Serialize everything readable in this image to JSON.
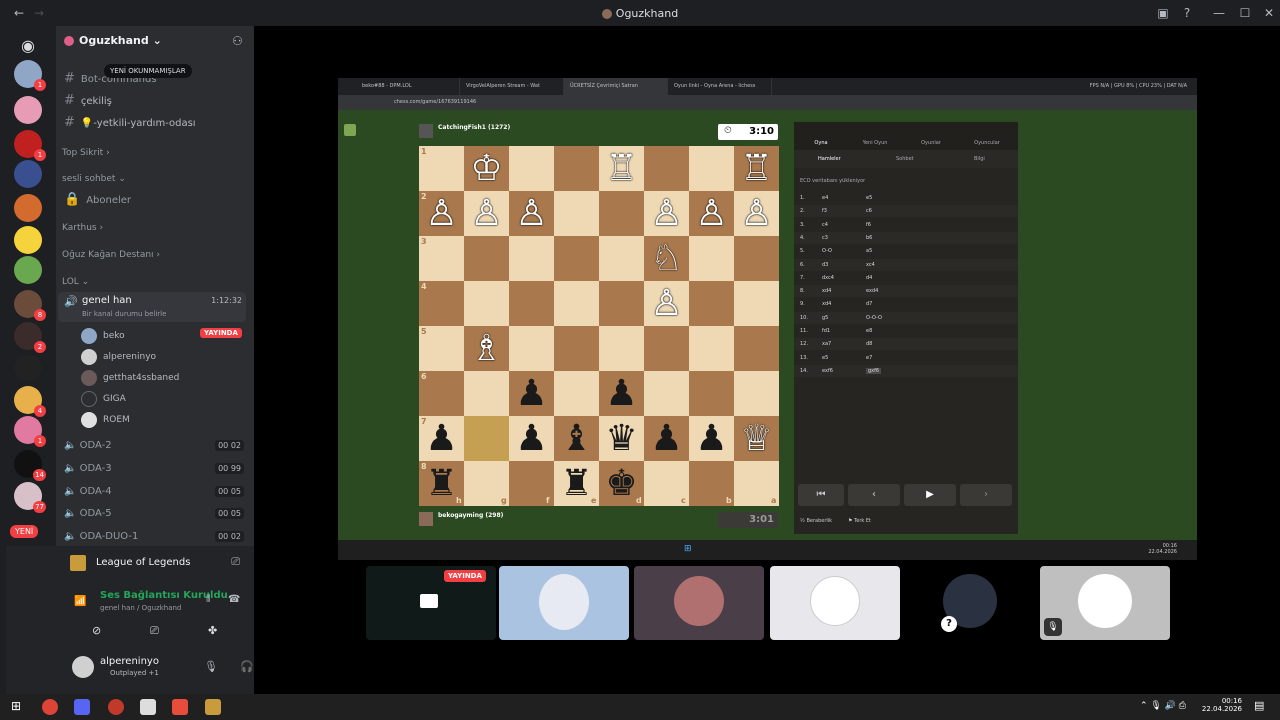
{
  "window": {
    "title": "Oguzkhand"
  },
  "server": {
    "name": "Oguzkhand",
    "tooltip": "YENİ OKUNMAMIŞLAR"
  },
  "text_channels": [
    {
      "name": "Bot-commands"
    },
    {
      "name": "çekiliş"
    },
    {
      "name": "💡-yetkili-yardım-odası"
    }
  ],
  "categories": {
    "top_sikrit": "Top Sikrit",
    "sesli_sohbet": "sesli sohbet",
    "aboneler": "Aboneler",
    "karthus": "Karthus",
    "oguz_kagan": "Oğuz Kağan Destanı",
    "lol": "LOL"
  },
  "voice_active": {
    "name": "genel han",
    "timer": "1:12:32",
    "status": "Bir kanal durumu belirle"
  },
  "voice_users": [
    {
      "name": "beko",
      "badge": "YAYINDA"
    },
    {
      "name": "alpereninyo"
    },
    {
      "name": "getthat4ssbaned"
    },
    {
      "name": "GIGA"
    },
    {
      "name": "ROEM"
    }
  ],
  "voice_channels": [
    {
      "name": "ODA-2",
      "a": "00",
      "b": "02"
    },
    {
      "name": "ODA-3",
      "a": "00",
      "b": "99"
    },
    {
      "name": "ODA-4",
      "a": "00",
      "b": "05"
    },
    {
      "name": "ODA-5",
      "a": "00",
      "b": "05"
    },
    {
      "name": "ODA-DUO-1",
      "a": "00",
      "b": "02"
    }
  ],
  "activity": {
    "game": "League of Legends"
  },
  "connection": {
    "status": "Ses Bağlantısı Kuruldu",
    "sub": "genel han / Oguzkhand"
  },
  "me": {
    "name": "alpereninyo",
    "status": "Outplayed +1"
  },
  "server_badges": {
    "new": "YENİ"
  },
  "browser": {
    "tabs": [
      "beko#88 - DPM.LOL",
      "VirgoVelAlperen Stream - Wat",
      "ÜCRETSİZ Çevrimiçi Satran",
      "Oyun linki - Oyna Arena - lichess"
    ],
    "url": "chess.com/game/167639119146",
    "stats": "FPS N/A | GPU 8% | CPU 23% | DAT N/A"
  },
  "chess": {
    "top_player": "CatchingFish1 (1272)",
    "top_clock": "3:10",
    "bottom_player": "bekogayming (298)",
    "bottom_clock": "3:01",
    "files": [
      "h",
      "g",
      "f",
      "e",
      "d",
      "c",
      "b",
      "a"
    ],
    "ranks": [
      "1",
      "2",
      "3",
      "4",
      "5",
      "6",
      "7",
      "8"
    ],
    "panel_tabs": [
      "Oyna",
      "Yeni Oyun",
      "Oyunlar",
      "Oyuncular"
    ],
    "sub_tabs": [
      "Hamleler",
      "Sohbet",
      "Bilgi"
    ],
    "opening": "ECO veritabanı yükleniyor",
    "moves": [
      [
        "1.",
        "e4",
        "e5"
      ],
      [
        "2.",
        "f3",
        "c6"
      ],
      [
        "3.",
        "c4",
        "f6"
      ],
      [
        "4.",
        "c3",
        "b6"
      ],
      [
        "5.",
        "O-O",
        "a5"
      ],
      [
        "6.",
        "d3",
        "xc4"
      ],
      [
        "7.",
        "dxc4",
        "d4"
      ],
      [
        "8.",
        "xd4",
        "exd4"
      ],
      [
        "9.",
        "xd4",
        "d7"
      ],
      [
        "10.",
        "g5",
        "O-O-O"
      ],
      [
        "11.",
        "fd1",
        "e8"
      ],
      [
        "12.",
        "xa7",
        "d8"
      ],
      [
        "13.",
        "e5",
        "e7"
      ],
      [
        "14.",
        "exf6",
        "gxf6"
      ]
    ],
    "draw": "Beraberlik",
    "resign": "Terk Et"
  },
  "tiles": {
    "live": "YAYINDA"
  },
  "clock": {
    "time": "00:16",
    "date": "22.04.2026"
  }
}
